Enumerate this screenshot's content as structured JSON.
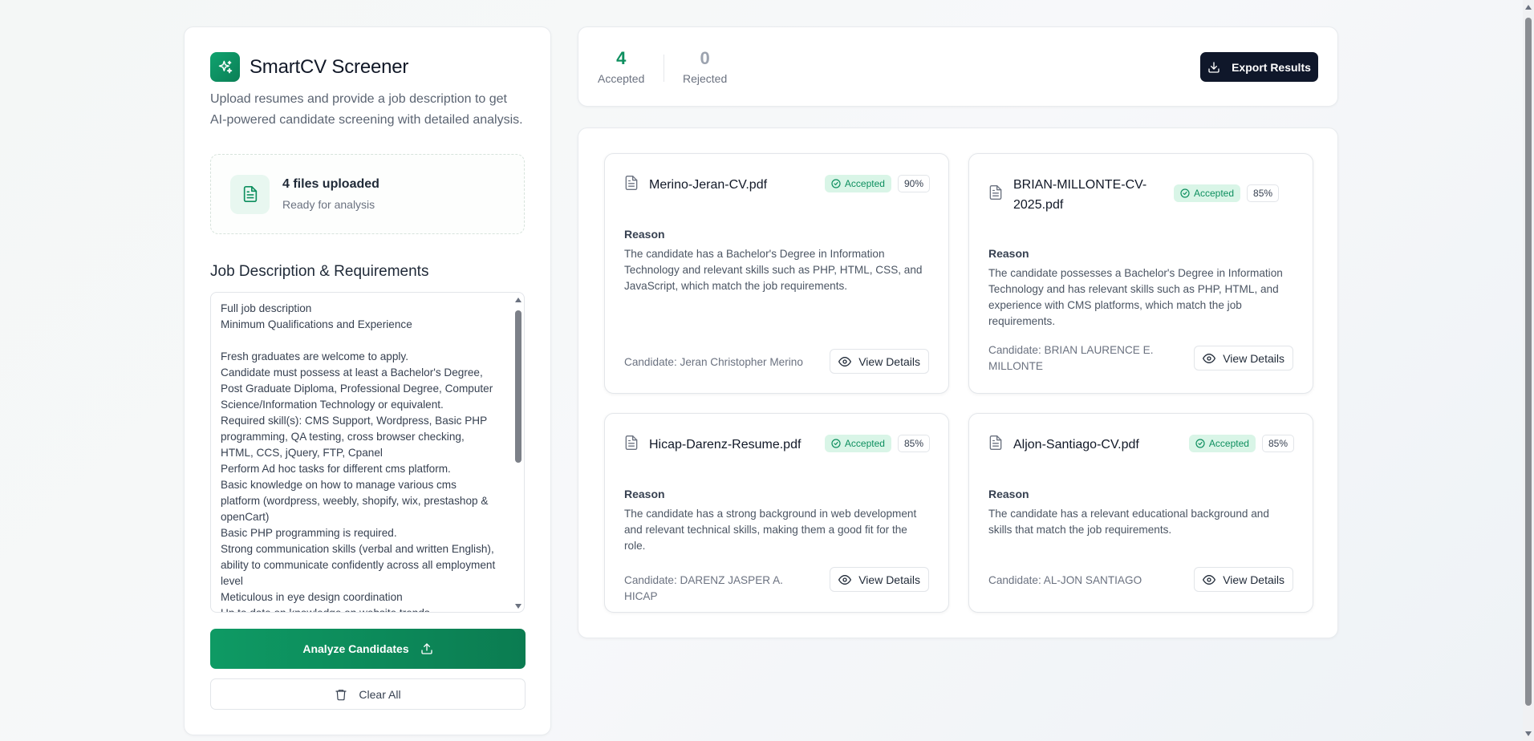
{
  "app": {
    "title": "SmartCV Screener",
    "description": "Upload resumes and provide a job description to get AI-powered candidate screening with detailed analysis.",
    "logo_icon": "sparkles-icon",
    "accent_color": "#0e9a64"
  },
  "upload": {
    "title": "4 files uploaded",
    "subtitle": "Ready for analysis"
  },
  "job_description": {
    "label": "Job Description & Requirements",
    "text": "Full job description\nMinimum Qualifications and Experience\n\nFresh graduates are welcome to apply.\nCandidate must possess at least a Bachelor's Degree, Post Graduate Diploma, Professional Degree, Computer Science/Information Technology or equivalent.\nRequired skill(s): CMS Support, Wordpress, Basic PHP programming, QA testing, cross browser checking, HTML, CCS, jQuery, FTP, Cpanel\nPerform Ad hoc tasks for different cms platform.\nBasic knowledge on how to manage various cms platform (wordpress, weebly, shopify, wix, prestashop & openCart)\nBasic PHP programming is required.\nStrong communication skills (verbal and written English), ability to communicate confidently across all employment level\nMeticulous in eye design coordination\nUp to date on knowledge on website trends"
  },
  "actions": {
    "analyze_label": "Analyze Candidates",
    "clear_label": "Clear All",
    "export_label": "Export Results"
  },
  "stats": {
    "accepted_count": "4",
    "accepted_label": "Accepted",
    "rejected_count": "0",
    "rejected_label": "Rejected"
  },
  "results": [
    {
      "file_name": "Merino-Jeran-CV.pdf",
      "status": "Accepted",
      "score": "90%",
      "reason_label": "Reason",
      "reason": "The candidate has a Bachelor's Degree in Information Technology and relevant skills such as PHP, HTML, CSS, and JavaScript, which match the job requirements.",
      "candidate": "Candidate: Jeran Christopher Merino",
      "view_label": "View Details"
    },
    {
      "file_name": "BRIAN-MILLONTE-CV-2025.pdf",
      "status": "Accepted",
      "score": "85%",
      "reason_label": "Reason",
      "reason": "The candidate possesses a Bachelor's Degree in Information Technology and has relevant skills such as PHP, HTML, and experience with CMS platforms, which match the job requirements.",
      "candidate": "Candidate: BRIAN LAURENCE E. MILLONTE",
      "view_label": "View Details"
    },
    {
      "file_name": "Hicap-Darenz-Resume.pdf",
      "status": "Accepted",
      "score": "85%",
      "reason_label": "Reason",
      "reason": "The candidate has a strong background in web development and relevant technical skills, making them a good fit for the role.",
      "candidate": "Candidate: DARENZ JASPER A. HICAP",
      "view_label": "View Details"
    },
    {
      "file_name": "Aljon-Santiago-CV.pdf",
      "status": "Accepted",
      "score": "85%",
      "reason_label": "Reason",
      "reason": "The candidate has a relevant educational background and skills that match the job requirements.",
      "candidate": "Candidate: AL-JON SANTIAGO",
      "view_label": "View Details"
    }
  ]
}
